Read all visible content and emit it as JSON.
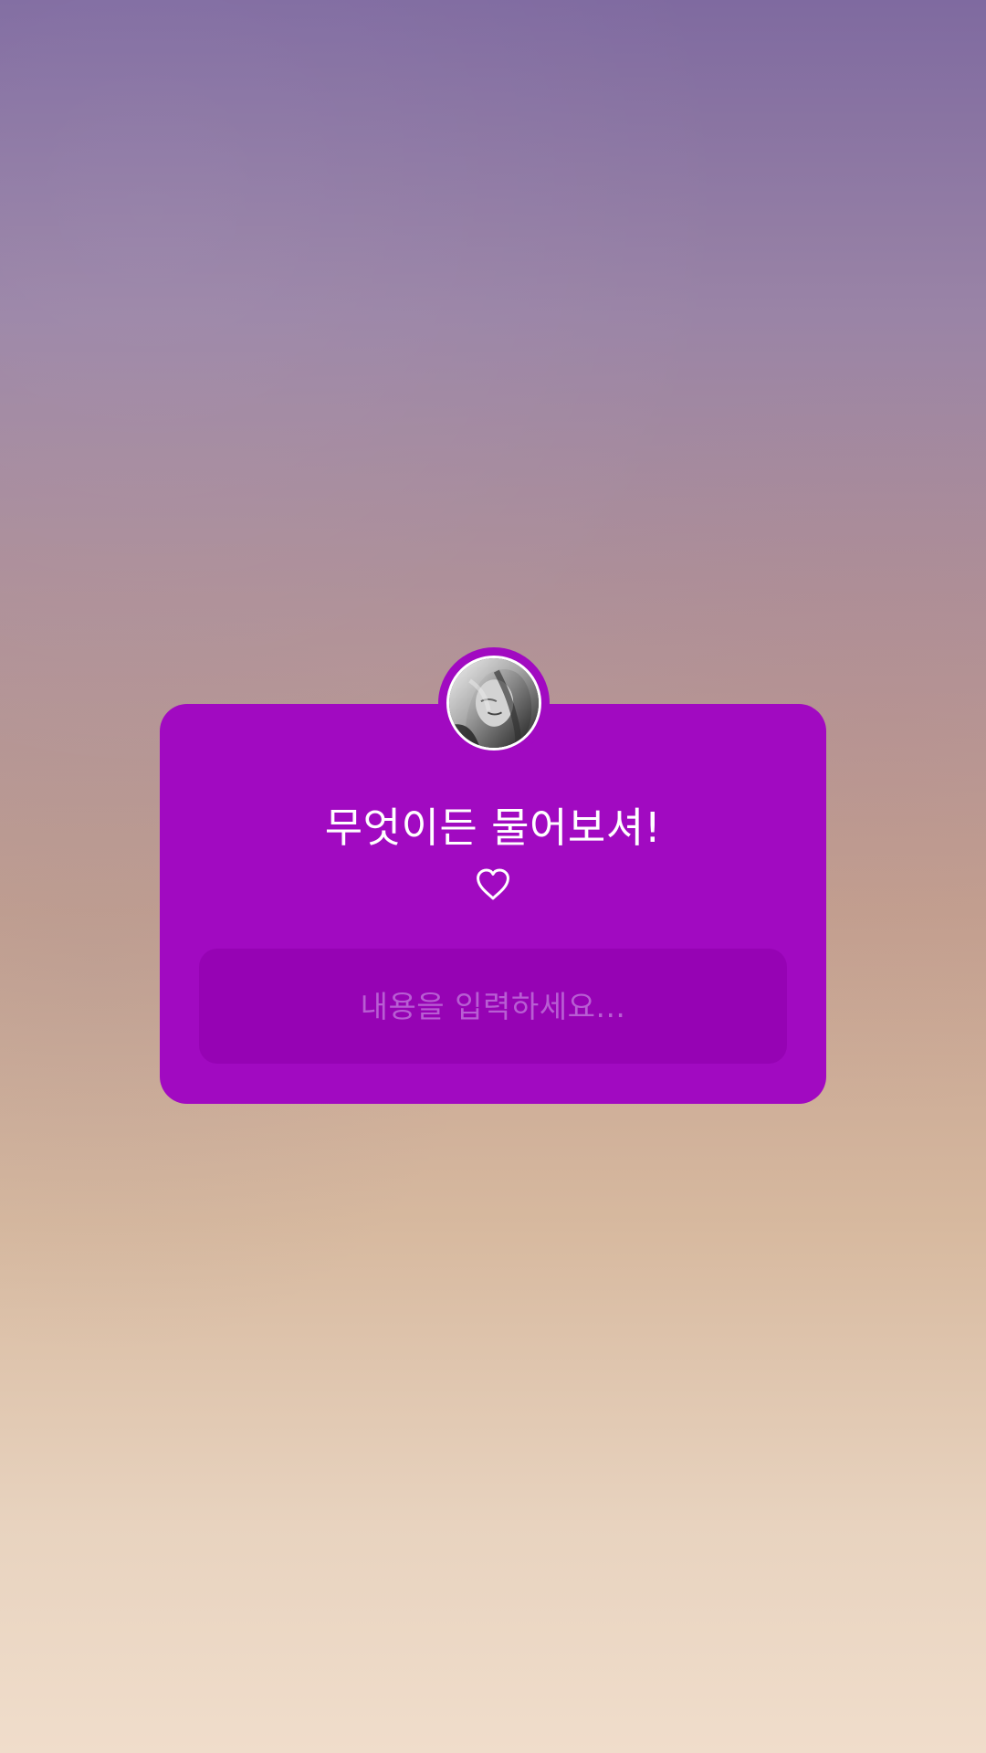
{
  "story": {
    "background_colors": {
      "top": "#7f6aa0",
      "middle": "#c3a090",
      "bottom": "#f0ddcb"
    },
    "question_sticker": {
      "title": "무엇이든 물어보셔!",
      "heart_icon": "heart-outline-icon",
      "input_placeholder": "내용을 입력하세요...",
      "colors": {
        "card": "#a10ac1",
        "input": "#9603b4",
        "text": "#ffffff",
        "placeholder": "#b85ed3"
      }
    },
    "profile": {
      "avatar_icon": "profile-avatar"
    }
  }
}
